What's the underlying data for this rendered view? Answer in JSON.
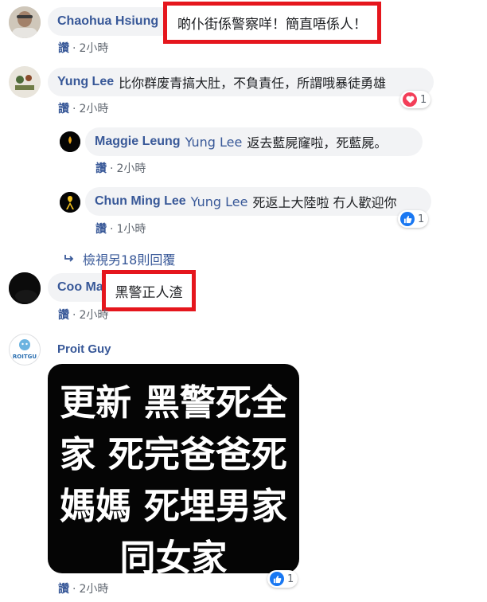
{
  "comments": [
    {
      "author": "Chaohua Hsiung",
      "author_visible": "Chaohua Hsiung",
      "text": "啲仆街係警察咩！簡直唔係人！",
      "like": "讚",
      "time": "2小時"
    },
    {
      "author": "Yung Lee",
      "text": "比你群废青搞大肚，不負責任，所謂哦暴徒勇雄",
      "like": "讚",
      "time": "2小時",
      "reaction": {
        "icon": "heart-icon",
        "count": "1",
        "color": "#f33e58"
      },
      "replies": [
        {
          "author": "Maggie Leung",
          "tag": "Yung Lee",
          "text": "返去藍屍窿啦，死藍屍。",
          "like": "讚",
          "time": "2小時"
        },
        {
          "author": "Chun Ming Lee",
          "tag": "Yung Lee",
          "text": "死返上大陸啦 冇人歡迎你",
          "like": "讚",
          "time": "1小時",
          "reaction": {
            "icon": "thumbs-up-icon",
            "count": "1",
            "color": "#1877f2"
          }
        }
      ],
      "more_replies": "檢視另18則回覆"
    },
    {
      "author": "Coo Ma",
      "text": "黑警正人渣",
      "like": "讚",
      "time": "2小時"
    },
    {
      "author": "Proit Guy",
      "avatar_text": "ROITGU",
      "image_lines": [
        "更新 黑警死全",
        "家 死完爸爸死",
        "媽媽 死埋男家",
        "同女家"
      ],
      "like": "讚",
      "time": "2小時",
      "reaction": {
        "icon": "thumbs-up-icon",
        "count": "1",
        "color": "#1877f2"
      }
    }
  ],
  "colors": {
    "highlight_border": "#e5161d",
    "name_link": "#385898",
    "bubble_bg": "#f2f3f5",
    "meta_text": "#606770"
  }
}
